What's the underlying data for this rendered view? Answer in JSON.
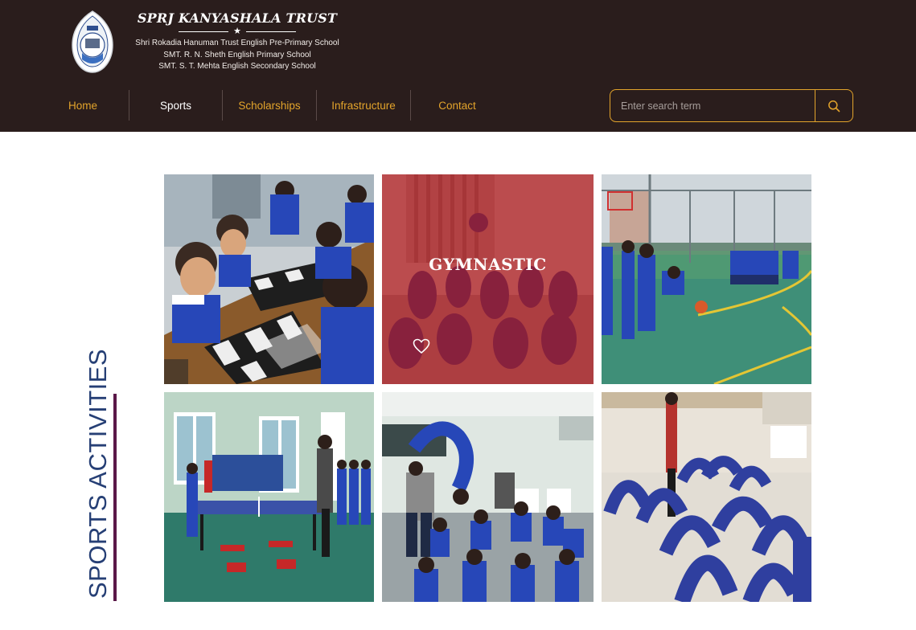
{
  "header": {
    "title": "SPRJ KANYASHALA TRUST",
    "schools": [
      "Shri Rokadia Hanuman Trust English Pre-Primary School",
      "SMT. R. N. Sheth English Primary School",
      "SMT. S. T. Mehta English Secondary School"
    ]
  },
  "nav": {
    "items": [
      {
        "label": "Home",
        "active": false
      },
      {
        "label": "Sports",
        "active": true
      },
      {
        "label": "Scholarships",
        "active": false
      },
      {
        "label": "Infrastructure",
        "active": false
      },
      {
        "label": "Contact",
        "active": false
      }
    ]
  },
  "search": {
    "placeholder": "Enter search term",
    "icon": "search-icon"
  },
  "section": {
    "heading": "SPORTS ACTIVITIES"
  },
  "gallery": {
    "tiles": [
      {
        "name": "chess",
        "overlay_title": "",
        "hovered": false
      },
      {
        "name": "gymnastic",
        "overlay_title": "GYMNASTIC",
        "hovered": true,
        "icon": "heart-icon"
      },
      {
        "name": "basketball",
        "overlay_title": "",
        "hovered": false
      },
      {
        "name": "table-tennis",
        "overlay_title": "",
        "hovered": false
      },
      {
        "name": "gymnastics-training",
        "overlay_title": "",
        "hovered": false
      },
      {
        "name": "yoga",
        "overlay_title": "",
        "hovered": false
      }
    ]
  },
  "colors": {
    "header_bg": "#2a1d1c",
    "nav_accent": "#e3a42b",
    "heading_text": "#263f75",
    "heading_bar": "#5a1848",
    "hover_overlay": "#b0181e"
  }
}
